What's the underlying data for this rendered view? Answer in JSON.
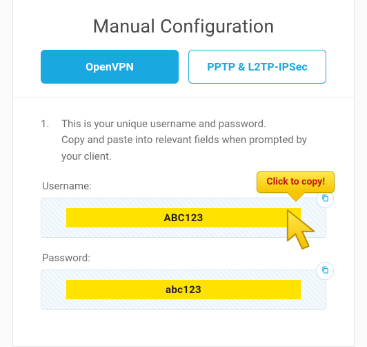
{
  "header": {
    "title": "Manual Configuration"
  },
  "tabs": {
    "openvpn": "OpenVPN",
    "pptp": "PPTP & L2TP-IPSec"
  },
  "step": {
    "number": "1.",
    "line1": "This is your unique username and password.",
    "line2": "Copy and paste into relevant fields when prompted by your client."
  },
  "fields": {
    "username_label": "Username:",
    "username_value": "ABC123",
    "password_label": "Password:",
    "password_value": "abc123"
  },
  "callout": {
    "text": "Click to copy!"
  }
}
